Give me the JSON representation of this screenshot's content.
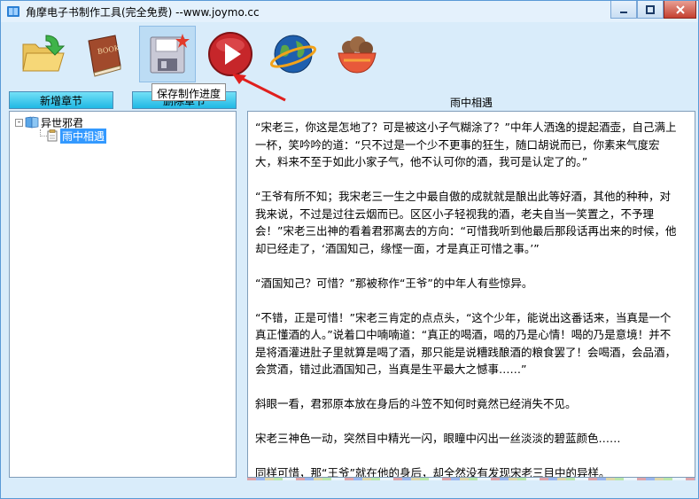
{
  "window": {
    "title": "角摩电子书制作工具(完全免费) --www.joymo.cc",
    "controls": [
      "minimize",
      "maximize",
      "close"
    ]
  },
  "toolbar": {
    "buttons": [
      {
        "icon": "folder-open-icon",
        "selected": false
      },
      {
        "icon": "book-icon",
        "selected": false
      },
      {
        "icon": "save-disk-icon",
        "selected": true
      },
      {
        "icon": "play-icon",
        "selected": false
      },
      {
        "icon": "globe-icon",
        "selected": false
      },
      {
        "icon": "food-bowl-icon",
        "selected": false
      }
    ],
    "tooltip": "保存制作进度"
  },
  "left_pane": {
    "add_button": "新增章节",
    "delete_button": "删除章节",
    "tree": {
      "root": {
        "label": "异世邪君",
        "expander": "-"
      },
      "children": [
        {
          "label": "雨中相遇",
          "selected": true
        }
      ]
    }
  },
  "content": {
    "chapter_title": "雨中相遇",
    "paragraphs": [
      "“宋老三，你这是怎地了？可是被这小子气糊涂了？”中年人洒逸的提起酒壶，自己满上一杯，笑吟吟的道：“只不过是一个少不更事的狂生，随口胡说而已，你素来气度宏大，料来不至于如此小家子气，他不认可你的酒，我可是认定了的。”",
      "“王爷有所不知；我宋老三一生之中最自傲的成就就是酿出此等好酒，其他的种种，对我来说，不过是过往云烟而已。区区小子轻视我的酒，老夫自当一笑置之，不予理会！”宋老三出神的看着君邪离去的方向：“可惜我听到他最后那段话再出来的时候，他却已经走了，‘酒国知己，缘悭一面，才是真正可惜之事。’”",
      "“酒国知己？可惜？”那被称作“王爷”的中年人有些惊异。",
      "“不错，正是可惜！”宋老三肯定的点点头，“这个少年，能说出这番话来，当真是一个真正懂酒的人。”说着口中喃喃道：“真正的喝酒，喝的乃是心情！喝的乃是意境！并不是将酒灌进肚子里就算是喝了酒，那只能是说糟践酿酒的粮食罢了！会喝酒，会品酒，会赏酒，错过此酒国知己，当真是生平最大之憾事……”",
      "斜眼一看，君邪原本放在身后的斗笠不知何时竟然已经消失不见。",
      "宋老三神色一动，突然目中精光一闪，眼瞳中闪出一丝淡淡的碧蓝颜色……",
      "同样可惜，那“王爷”就在他的身后，却全然没有发现宋老三目中的异样。"
    ]
  },
  "colors": {
    "accent": "#1fb8e5",
    "selection": "#3399ff",
    "close": "#c4402f"
  }
}
